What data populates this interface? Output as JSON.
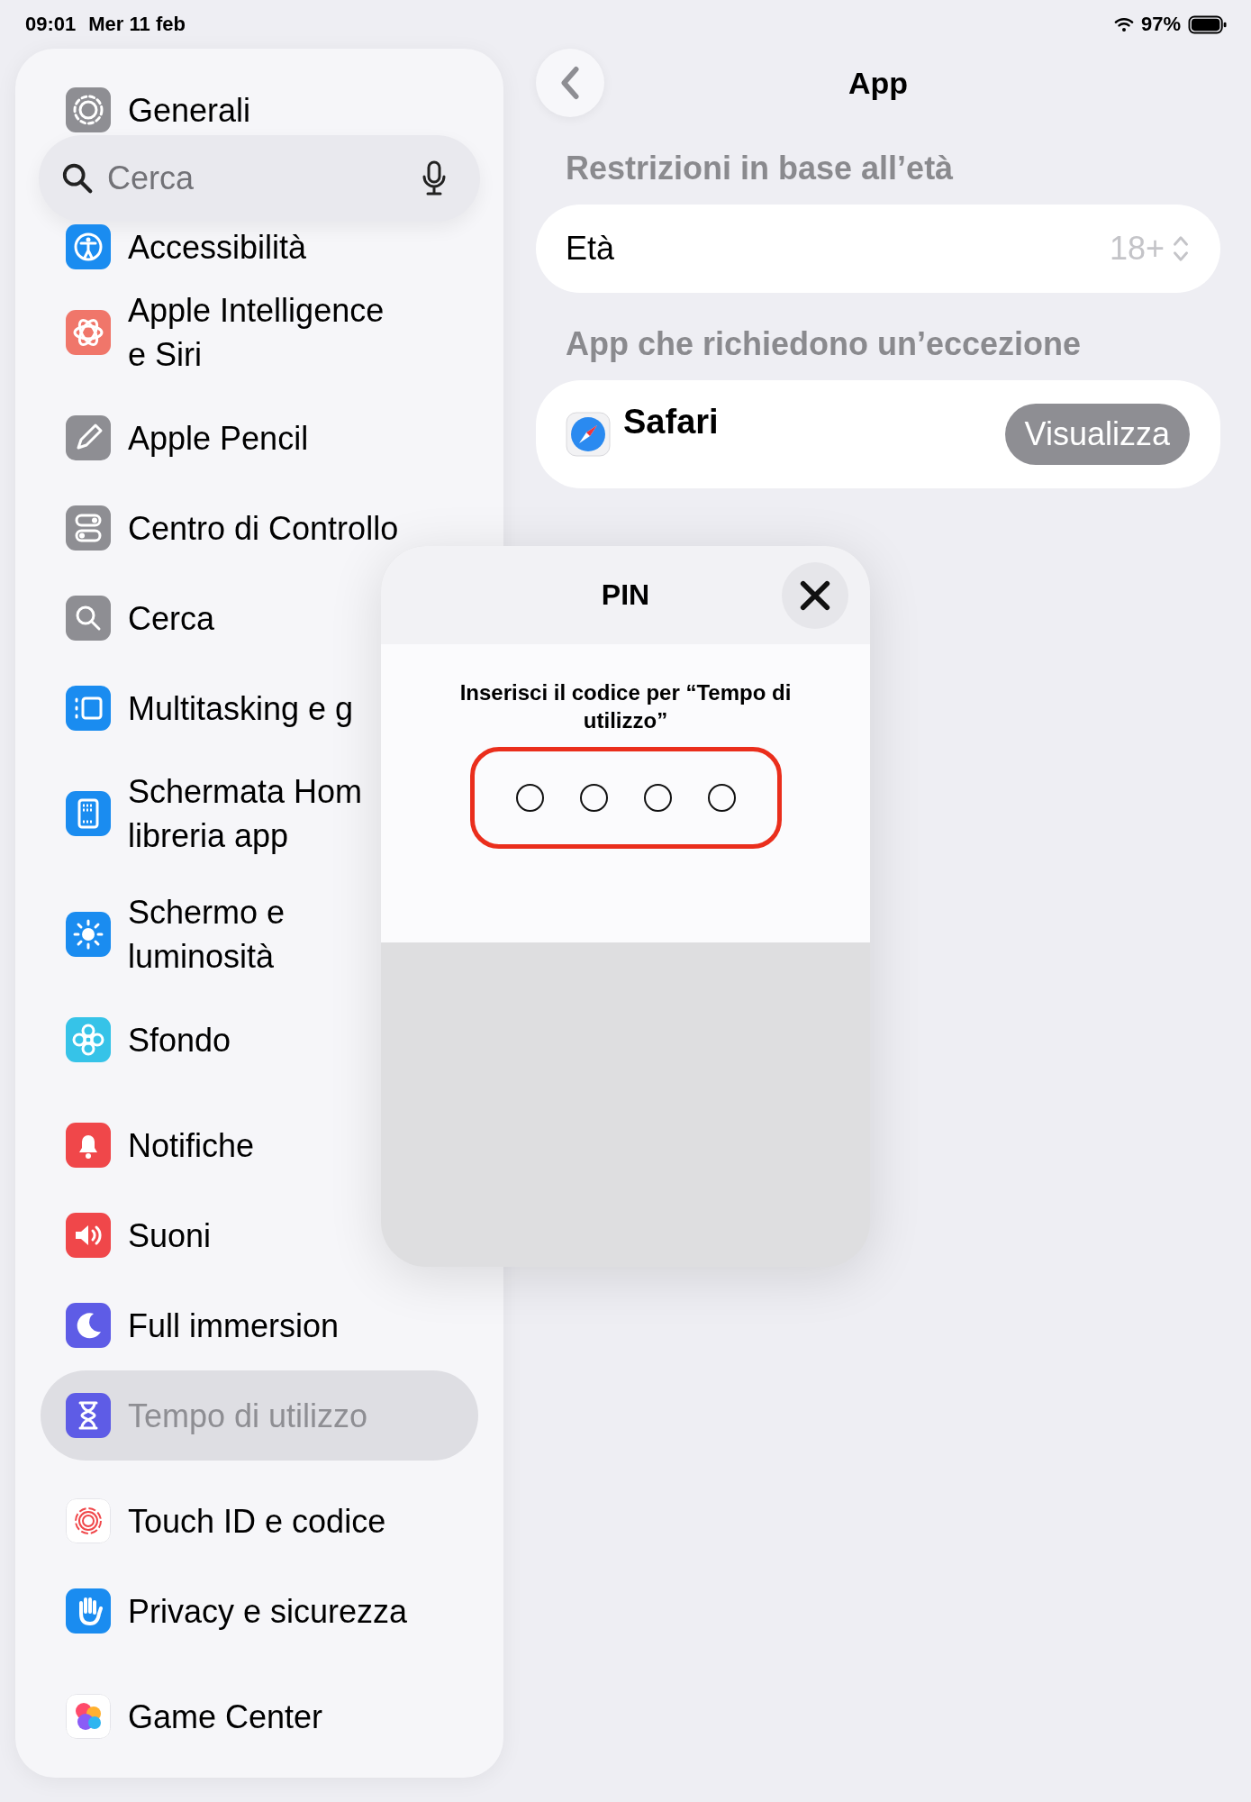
{
  "status_bar": {
    "time": "09:01",
    "date": "Mer 11 feb",
    "battery": "97%"
  },
  "sidebar": {
    "search": {
      "placeholder": "Cerca"
    },
    "groups": [
      {
        "items": [
          {
            "lines": [
              "Generali"
            ],
            "color": "#8e8e93",
            "selected": false
          },
          {
            "lines": [
              "Accessibilità"
            ],
            "color": "#1a8cf0",
            "selected": false
          },
          {
            "lines": [
              "Apple Intelligence",
              "e Siri"
            ],
            "color": "#f0766a",
            "selected": false
          },
          {
            "lines": [
              "Apple Pencil"
            ],
            "color": "#8e8e93",
            "selected": false
          },
          {
            "lines": [
              "Centro di Controllo"
            ],
            "color": "#8e8e93",
            "selected": false
          },
          {
            "lines": [
              "Cerca"
            ],
            "color": "#8e8e93",
            "selected": false
          },
          {
            "lines": [
              "Multitasking e g"
            ],
            "color": "#1a8cf0",
            "selected": false
          },
          {
            "lines": [
              "Schermata Hom",
              "libreria app"
            ],
            "color": "#1a8cf0",
            "selected": false
          },
          {
            "lines": [
              "Schermo e",
              "luminosità"
            ],
            "color": "#1a8cf0",
            "selected": false
          },
          {
            "lines": [
              "Sfondo"
            ],
            "color": "#36c3e8",
            "selected": false
          }
        ]
      },
      {
        "items": [
          {
            "lines": [
              "Notifiche"
            ],
            "color": "#f0474a",
            "selected": false
          },
          {
            "lines": [
              "Suoni"
            ],
            "color": "#f0474a",
            "selected": false
          },
          {
            "lines": [
              "Full immersion"
            ],
            "color": "#5e5ce6",
            "selected": false
          },
          {
            "lines": [
              "Tempo di utilizzo"
            ],
            "color": "#5e5ce6",
            "selected": true
          }
        ]
      },
      {
        "items": [
          {
            "lines": [
              "Touch ID e codice"
            ],
            "color": "#ffffff",
            "selected": false
          },
          {
            "lines": [
              "Privacy e sicurezza"
            ],
            "color": "#1a8cf0",
            "selected": false
          }
        ]
      },
      {
        "items": [
          {
            "lines": [
              "Game Center"
            ],
            "color": "#ffffff",
            "selected": false
          }
        ]
      }
    ]
  },
  "detail": {
    "title": "App",
    "sections": [
      {
        "header": "Restrizioni in base all’età",
        "rows": [
          {
            "kind": "picker",
            "label": "Età",
            "value": "18+"
          }
        ]
      },
      {
        "header": "App che richiedono un’eccezione",
        "rows": [
          {
            "kind": "app",
            "label": "Safari",
            "button": "Visualizza"
          }
        ]
      }
    ]
  },
  "pin_sheet": {
    "title": "PIN",
    "prompt": "Inserisci il codice per “Tempo di utilizzo”",
    "highlighted": true,
    "digits": [
      {
        "filled": false
      },
      {
        "filled": false
      },
      {
        "filled": false
      },
      {
        "filled": false
      }
    ]
  }
}
